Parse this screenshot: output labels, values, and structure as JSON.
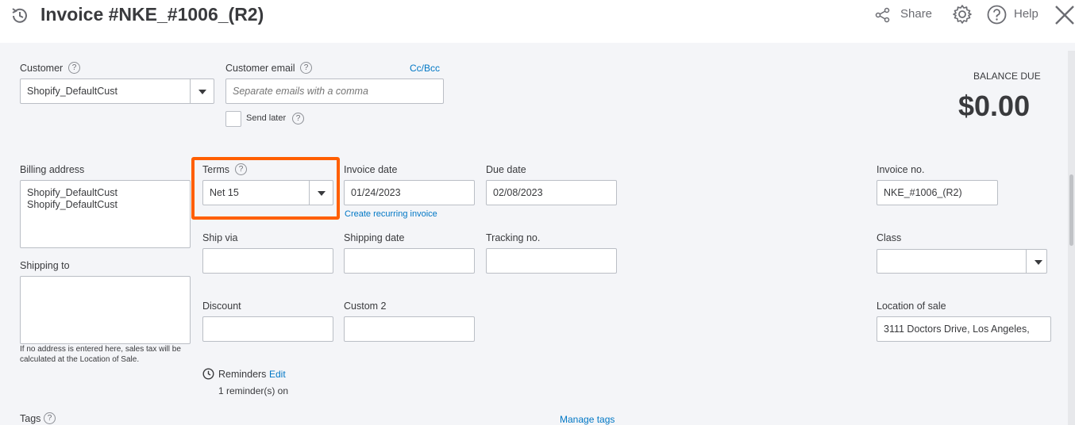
{
  "header": {
    "title": "Invoice #NKE_#1006_(R2)",
    "share_label": "Share",
    "help_label": "Help"
  },
  "customer": {
    "label": "Customer",
    "value": "Shopify_DefaultCust"
  },
  "customer_email": {
    "label": "Customer email",
    "placeholder": "Separate emails with a comma",
    "ccbcc": "Cc/Bcc",
    "send_later": "Send later"
  },
  "balance": {
    "label": "BALANCE DUE",
    "amount": "$0.00"
  },
  "billing": {
    "label": "Billing address",
    "line1": "Shopify_DefaultCust",
    "line2": "Shopify_DefaultCust"
  },
  "terms": {
    "label": "Terms",
    "value": "Net 15"
  },
  "invoice_date": {
    "label": "Invoice date",
    "value": "01/24/2023",
    "recurring": "Create recurring invoice"
  },
  "due_date": {
    "label": "Due date",
    "value": "02/08/2023"
  },
  "invoice_no": {
    "label": "Invoice no.",
    "value": "NKE_#1006_(R2)"
  },
  "ship_via": {
    "label": "Ship via",
    "value": ""
  },
  "shipping_date": {
    "label": "Shipping date",
    "value": ""
  },
  "tracking_no": {
    "label": "Tracking no.",
    "value": ""
  },
  "class": {
    "label": "Class",
    "value": ""
  },
  "shipping_to": {
    "label": "Shipping to",
    "note": "If no address is entered here, sales tax will be calculated at the Location of Sale."
  },
  "discount": {
    "label": "Discount",
    "value": ""
  },
  "custom2": {
    "label": "Custom 2",
    "value": ""
  },
  "location_of_sale": {
    "label": "Location of sale",
    "value": "3111  Doctors Drive, Los Angeles,"
  },
  "reminders": {
    "label": "Reminders",
    "edit": "Edit",
    "status": "1 reminder(s) on"
  },
  "tags": {
    "label": "Tags",
    "manage": "Manage tags"
  },
  "colors": {
    "highlight": "#ff5f00",
    "link": "#0077c5"
  }
}
